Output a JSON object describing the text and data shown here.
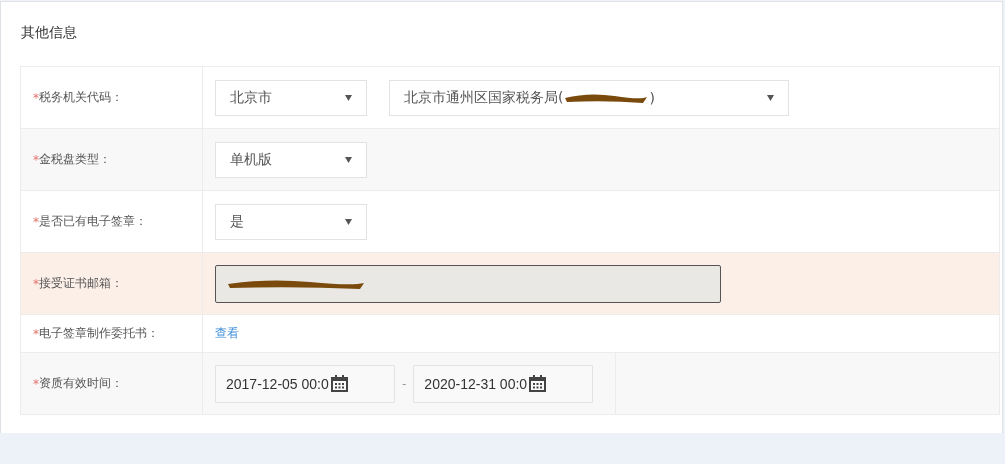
{
  "section": {
    "title": "其他信息"
  },
  "rows": [
    {
      "kind": "select",
      "label": "税务机关代码：",
      "required_mark": "*",
      "highlighted": false,
      "selects": [
        {
          "value": "北京市",
          "redacted": false
        },
        {
          "value": "北京市通州区国家税务局(",
          "suffix": ")",
          "redacted": true
        }
      ]
    },
    {
      "kind": "select",
      "label": "金税盘类型：",
      "required_mark": "*",
      "highlighted": false,
      "selects": [
        {
          "value": "单机版",
          "redacted": false
        }
      ]
    },
    {
      "kind": "select",
      "label": "是否已有电子签章：",
      "required_mark": "*",
      "highlighted": false,
      "selects": [
        {
          "value": "是",
          "redacted": false
        }
      ]
    },
    {
      "kind": "email",
      "label": "接受证书邮箱：",
      "required_mark": "*",
      "highlighted": true,
      "disabled": true
    },
    {
      "kind": "link",
      "label": "电子签章制作委托书：",
      "required_mark": "*",
      "highlighted": false,
      "link": "查看"
    },
    {
      "kind": "daterange",
      "label": "资质有效时间：",
      "required_mark": "*",
      "highlighted": false,
      "start": "2017-12-05 00:0",
      "separator": "-",
      "end": "2020-12-31 00:0"
    }
  ]
}
